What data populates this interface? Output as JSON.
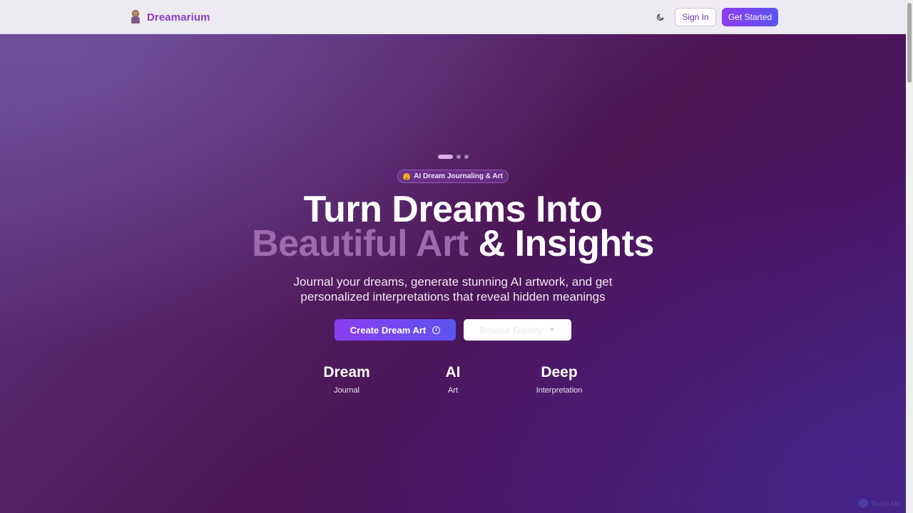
{
  "header": {
    "brand_name": "Dreamarium",
    "sign_in_label": "Sign In",
    "get_started_label": "Get Started"
  },
  "hero": {
    "badge_text": "AI Dream Journaling & Art",
    "headline_line1": "Turn Dreams Into",
    "headline_accent": "Beautiful Art",
    "headline_rest": "& Insights",
    "subtitle_line1": "Journal your dreams, generate stunning AI artwork, and get",
    "subtitle_line2": "personalized interpretations that reveal hidden meanings",
    "create_button_label": "Create Dream Art",
    "browse_button_label": "Browse Gallery",
    "carousel": {
      "slides": 3,
      "active_index": 0
    },
    "stats": [
      {
        "value": "Dream",
        "label": "Journal"
      },
      {
        "value": "AI",
        "label": "Art"
      },
      {
        "value": "Deep",
        "label": "Interpretation"
      }
    ]
  },
  "watermark": {
    "text": "Tooltip Me"
  },
  "colors": {
    "brand": "#8a3fc4",
    "button_gradient_start": "#8b3df0",
    "button_gradient_end": "#5b54f0",
    "headline_accent": "#a06ab0"
  },
  "icons": {
    "logo": "dream-character-logo-icon",
    "theme_toggle": "moon-icon",
    "badge": "mushroom-icon",
    "create_button": "plus-circle-icon",
    "browse_button": "sparkle-icon"
  }
}
